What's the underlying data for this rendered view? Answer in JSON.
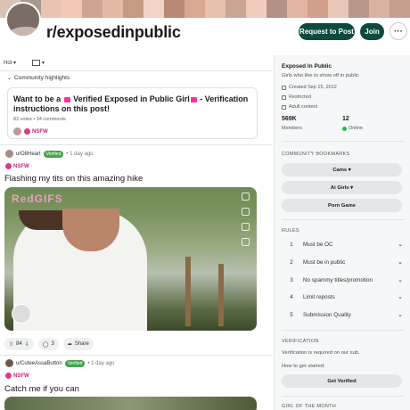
{
  "banner": {
    "colors": [
      "#d8c3b8",
      "#a8998f",
      "#e8c4b3",
      "#f3c9b6",
      "#cfa493",
      "#e6b9a7",
      "#c99a83",
      "#f1d4c5",
      "#b88a76",
      "#d9a892",
      "#e7c0ac",
      "#c8a595",
      "#f0ccbc",
      "#b39184",
      "#e2b6a2",
      "#d0a08c",
      "#e9c7b9",
      "#ba9889",
      "#dbb2a1",
      "#c69e8d"
    ]
  },
  "header": {
    "subreddit": "r/exposedinpublic",
    "request_label": "Request to Post",
    "join_label": "Join",
    "more_label": "···"
  },
  "feed_bar": {
    "sort": "Hot ▾",
    "view": "▾"
  },
  "highlights": {
    "heading": "Community highlights",
    "card": {
      "title_a": "Want to be a ",
      "title_b": " Verified Exposed in Public Girl",
      "title_c": " - Verification instructions on this post!",
      "meta": "83 votes • 34 comments",
      "nsfw": "NSFW"
    }
  },
  "posts": [
    {
      "user": "u/O8Heart",
      "badge": "Verified",
      "time": "• 1 day ago",
      "nsfw": "NSFW",
      "title": "Flashing my tits on this amazing hike",
      "watermark": "RedGIFS",
      "votes": "84",
      "comments": "3",
      "share": "Share"
    },
    {
      "user": "u/CuteeAssaButton",
      "badge": "Verified",
      "time": "• 1 day ago",
      "nsfw": "NSFW",
      "title": "Catch me if you can"
    }
  ],
  "sidebar": {
    "name": "Exposed In Public",
    "tagline": "Girls who like to show off in public",
    "created": "Created Sep 15, 2012",
    "restricted": "Restricted",
    "adult": "Adult content",
    "members_count": "569K",
    "members_label": "Members",
    "online_count": "12",
    "online_label": "Online",
    "bookmarks_heading": "COMMUNITY BOOKMARKS",
    "bookmarks": [
      "Cams ▾",
      "Ai Girls ▾",
      "Porn Game"
    ],
    "rules_heading": "RULES",
    "rules": [
      {
        "num": "1",
        "text": "Must be OC"
      },
      {
        "num": "2",
        "text": "Must be in public"
      },
      {
        "num": "3",
        "text": "No spammy titles/promotion"
      },
      {
        "num": "4",
        "text": "Limit reposts"
      },
      {
        "num": "5",
        "text": "Submission Quality"
      }
    ],
    "verification_heading": "VERIFICATION",
    "verification_text": "Verification is required on our sub.",
    "how_to": "How to get started:",
    "get_verified": "Get Verified",
    "girl_heading": "GIRL OF THE MONTH"
  }
}
